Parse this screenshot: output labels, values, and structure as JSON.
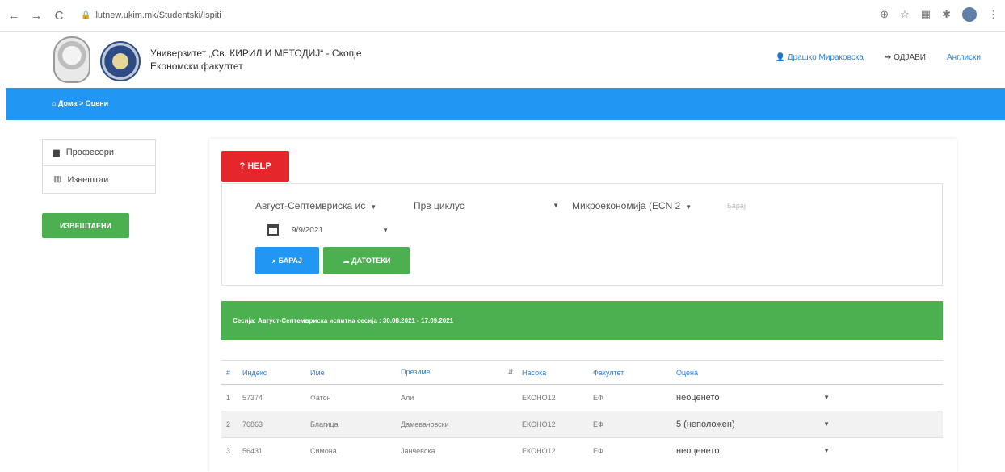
{
  "browser": {
    "url": "lutnew.ukim.mk/Studentski/Ispiti",
    "back_icon": "←",
    "forward_icon": "→",
    "reload_icon": "C"
  },
  "header": {
    "university": "Универзитет „Св. КИРИЛ И МЕТОДИЈ“ - Скопје",
    "faculty": "Економски факултет",
    "user": "Драшко Мираковска",
    "logout": "ОДЈАВИ",
    "language": "Англиски"
  },
  "breadcrumb": {
    "home": "Дома",
    "current": "Оцени",
    "separator": ">"
  },
  "sidebar": {
    "items": [
      {
        "label": "Професори"
      },
      {
        "label": "Извештаи"
      }
    ],
    "green_button": "ИЗВЕШТАЕНИ"
  },
  "main": {
    "help_button": "HELP",
    "filters": {
      "session": "Август-Септемвриска ис",
      "cycle": "Прв циклус",
      "subject": "Микроекономија (ECN 2",
      "subject_extra": "Барај",
      "date": "9/9/2021"
    },
    "search_button": "БАРАЈ",
    "files_button": "ДАТОТЕКИ",
    "alert": "Сесија: Август-Септемвриска испитна сесија : 30.08.2021 - 17.09.2021"
  },
  "table": {
    "headers": [
      "#",
      "Индекс",
      "Име",
      "Презиме",
      "Насока",
      "Факултет",
      "Оцена"
    ],
    "rows": [
      {
        "n": "1",
        "index": "57374",
        "first": "Фатон",
        "last": "Али",
        "program": "ЕКОНО12",
        "faculty": "ЕФ",
        "grade": "неоценето"
      },
      {
        "n": "2",
        "index": "76863",
        "first": "Благица",
        "last": "Дамевачовски",
        "program": "ЕКОНО12",
        "faculty": "ЕФ",
        "grade": "5 (неположен)"
      },
      {
        "n": "3",
        "index": "56431",
        "first": "Симона",
        "last": "Јанчевска",
        "program": "ЕКОНО12",
        "faculty": "ЕФ",
        "grade": "неоценето"
      }
    ]
  },
  "colors": {
    "primary_blue": "#2196f3",
    "success_green": "#4caf50",
    "help_red": "#e5262b"
  }
}
